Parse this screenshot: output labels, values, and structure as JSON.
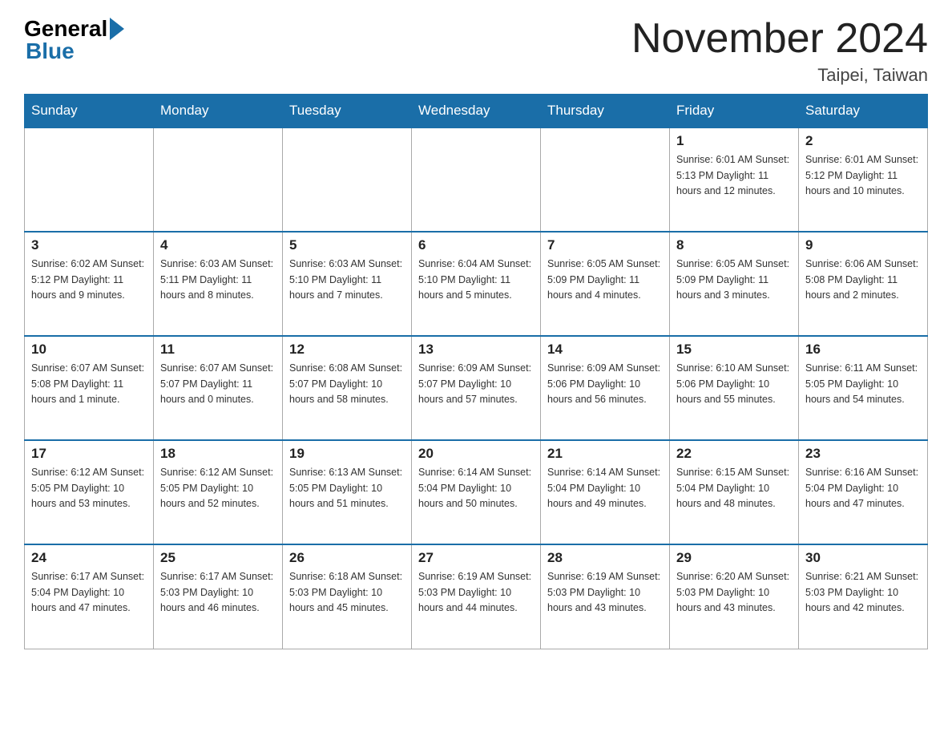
{
  "logo": {
    "general": "General",
    "blue": "Blue"
  },
  "title": "November 2024",
  "location": "Taipei, Taiwan",
  "weekdays": [
    "Sunday",
    "Monday",
    "Tuesday",
    "Wednesday",
    "Thursday",
    "Friday",
    "Saturday"
  ],
  "weeks": [
    [
      {
        "day": "",
        "info": ""
      },
      {
        "day": "",
        "info": ""
      },
      {
        "day": "",
        "info": ""
      },
      {
        "day": "",
        "info": ""
      },
      {
        "day": "",
        "info": ""
      },
      {
        "day": "1",
        "info": "Sunrise: 6:01 AM\nSunset: 5:13 PM\nDaylight: 11 hours\nand 12 minutes."
      },
      {
        "day": "2",
        "info": "Sunrise: 6:01 AM\nSunset: 5:12 PM\nDaylight: 11 hours\nand 10 minutes."
      }
    ],
    [
      {
        "day": "3",
        "info": "Sunrise: 6:02 AM\nSunset: 5:12 PM\nDaylight: 11 hours\nand 9 minutes."
      },
      {
        "day": "4",
        "info": "Sunrise: 6:03 AM\nSunset: 5:11 PM\nDaylight: 11 hours\nand 8 minutes."
      },
      {
        "day": "5",
        "info": "Sunrise: 6:03 AM\nSunset: 5:10 PM\nDaylight: 11 hours\nand 7 minutes."
      },
      {
        "day": "6",
        "info": "Sunrise: 6:04 AM\nSunset: 5:10 PM\nDaylight: 11 hours\nand 5 minutes."
      },
      {
        "day": "7",
        "info": "Sunrise: 6:05 AM\nSunset: 5:09 PM\nDaylight: 11 hours\nand 4 minutes."
      },
      {
        "day": "8",
        "info": "Sunrise: 6:05 AM\nSunset: 5:09 PM\nDaylight: 11 hours\nand 3 minutes."
      },
      {
        "day": "9",
        "info": "Sunrise: 6:06 AM\nSunset: 5:08 PM\nDaylight: 11 hours\nand 2 minutes."
      }
    ],
    [
      {
        "day": "10",
        "info": "Sunrise: 6:07 AM\nSunset: 5:08 PM\nDaylight: 11 hours\nand 1 minute."
      },
      {
        "day": "11",
        "info": "Sunrise: 6:07 AM\nSunset: 5:07 PM\nDaylight: 11 hours\nand 0 minutes."
      },
      {
        "day": "12",
        "info": "Sunrise: 6:08 AM\nSunset: 5:07 PM\nDaylight: 10 hours\nand 58 minutes."
      },
      {
        "day": "13",
        "info": "Sunrise: 6:09 AM\nSunset: 5:07 PM\nDaylight: 10 hours\nand 57 minutes."
      },
      {
        "day": "14",
        "info": "Sunrise: 6:09 AM\nSunset: 5:06 PM\nDaylight: 10 hours\nand 56 minutes."
      },
      {
        "day": "15",
        "info": "Sunrise: 6:10 AM\nSunset: 5:06 PM\nDaylight: 10 hours\nand 55 minutes."
      },
      {
        "day": "16",
        "info": "Sunrise: 6:11 AM\nSunset: 5:05 PM\nDaylight: 10 hours\nand 54 minutes."
      }
    ],
    [
      {
        "day": "17",
        "info": "Sunrise: 6:12 AM\nSunset: 5:05 PM\nDaylight: 10 hours\nand 53 minutes."
      },
      {
        "day": "18",
        "info": "Sunrise: 6:12 AM\nSunset: 5:05 PM\nDaylight: 10 hours\nand 52 minutes."
      },
      {
        "day": "19",
        "info": "Sunrise: 6:13 AM\nSunset: 5:05 PM\nDaylight: 10 hours\nand 51 minutes."
      },
      {
        "day": "20",
        "info": "Sunrise: 6:14 AM\nSunset: 5:04 PM\nDaylight: 10 hours\nand 50 minutes."
      },
      {
        "day": "21",
        "info": "Sunrise: 6:14 AM\nSunset: 5:04 PM\nDaylight: 10 hours\nand 49 minutes."
      },
      {
        "day": "22",
        "info": "Sunrise: 6:15 AM\nSunset: 5:04 PM\nDaylight: 10 hours\nand 48 minutes."
      },
      {
        "day": "23",
        "info": "Sunrise: 6:16 AM\nSunset: 5:04 PM\nDaylight: 10 hours\nand 47 minutes."
      }
    ],
    [
      {
        "day": "24",
        "info": "Sunrise: 6:17 AM\nSunset: 5:04 PM\nDaylight: 10 hours\nand 47 minutes."
      },
      {
        "day": "25",
        "info": "Sunrise: 6:17 AM\nSunset: 5:03 PM\nDaylight: 10 hours\nand 46 minutes."
      },
      {
        "day": "26",
        "info": "Sunrise: 6:18 AM\nSunset: 5:03 PM\nDaylight: 10 hours\nand 45 minutes."
      },
      {
        "day": "27",
        "info": "Sunrise: 6:19 AM\nSunset: 5:03 PM\nDaylight: 10 hours\nand 44 minutes."
      },
      {
        "day": "28",
        "info": "Sunrise: 6:19 AM\nSunset: 5:03 PM\nDaylight: 10 hours\nand 43 minutes."
      },
      {
        "day": "29",
        "info": "Sunrise: 6:20 AM\nSunset: 5:03 PM\nDaylight: 10 hours\nand 43 minutes."
      },
      {
        "day": "30",
        "info": "Sunrise: 6:21 AM\nSunset: 5:03 PM\nDaylight: 10 hours\nand 42 minutes."
      }
    ]
  ]
}
